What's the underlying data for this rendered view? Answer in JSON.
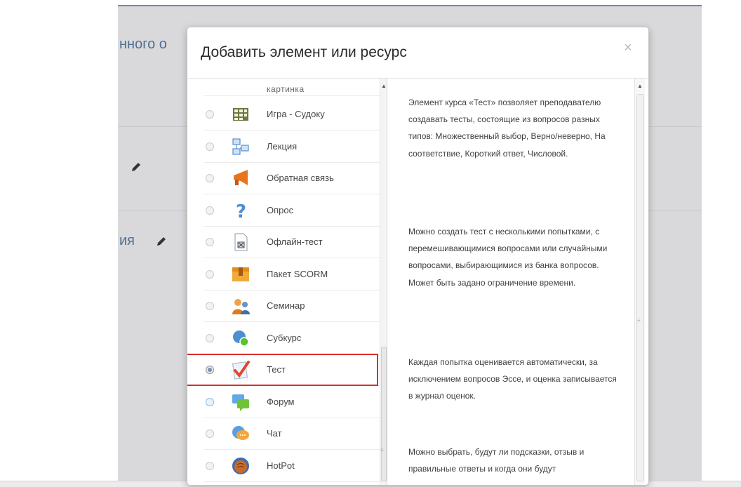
{
  "background": {
    "heading_top": "нного о",
    "heading_bottom": "ия"
  },
  "modal": {
    "title": "Добавить элемент или ресурс",
    "close": "×",
    "partial_item": "картинка",
    "selected_item": "Тест",
    "items": [
      {
        "label": "Игра - Судоку",
        "icon": "sudoku-icon",
        "state": "unchecked"
      },
      {
        "label": "Лекция",
        "icon": "lesson-icon",
        "state": "unchecked"
      },
      {
        "label": "Обратная связь",
        "icon": "feedback-megaphone-icon",
        "state": "unchecked"
      },
      {
        "label": "Опрос",
        "icon": "question-mark-icon",
        "state": "unchecked"
      },
      {
        "label": "Офлайн-тест",
        "icon": "offline-quiz-icon",
        "state": "unchecked"
      },
      {
        "label": "Пакет SCORM",
        "icon": "scorm-package-icon",
        "state": "unchecked"
      },
      {
        "label": "Семинар",
        "icon": "workshop-people-icon",
        "state": "unchecked"
      },
      {
        "label": "Субкурс",
        "icon": "subcourse-icon",
        "state": "unchecked"
      },
      {
        "label": "Тест",
        "icon": "quiz-checkmark-icon",
        "state": "checked"
      },
      {
        "label": "Форум",
        "icon": "forum-icon",
        "state": "unchecked-blue"
      },
      {
        "label": "Чат",
        "icon": "chat-icon",
        "state": "unchecked"
      },
      {
        "label": "HotPot",
        "icon": "hotpot-icon",
        "state": "unchecked"
      }
    ],
    "description": [
      "Элемент курса «Тест» позволяет преподавателю создавать тесты, состоящие из вопросов разных типов: Множественный выбор, Верно/неверно, На соответствие, Короткий ответ, Числовой.",
      "Можно создать тест с несколькими попытками, с перемешивающимися вопросами или случайными вопросами, выбирающимися из банка вопросов. Может быть задано ограничение времени.",
      "Каждая попытка оценивается автоматически, за исключением вопросов Эссе, и оценка записывается в журнал оценок.",
      "Можно выбрать, будут ли подсказки, отзыв и правильные ответы и когда они будут"
    ]
  },
  "colors": {
    "highlight": "#d6302f",
    "heading_link": "#4e6f93"
  }
}
